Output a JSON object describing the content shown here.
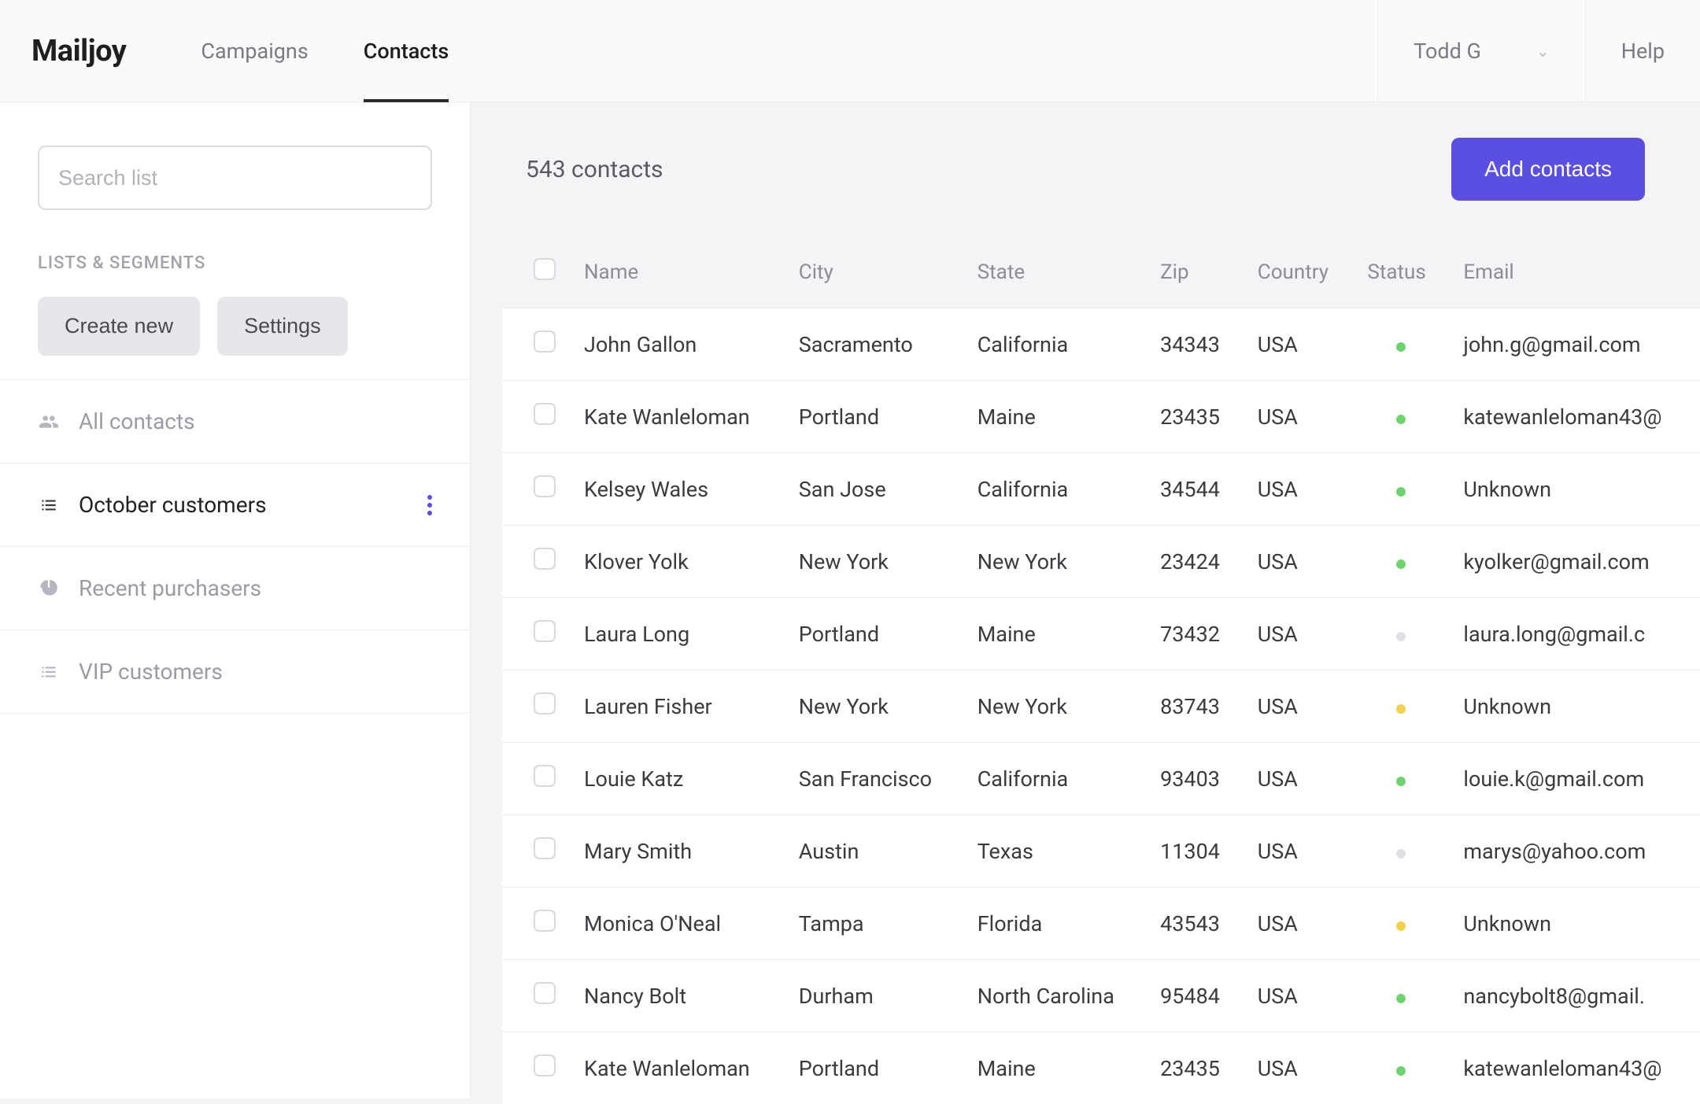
{
  "header": {
    "brand": "Mailjoy",
    "nav": {
      "campaigns": "Campaigns",
      "contacts": "Contacts"
    },
    "user": "Todd G",
    "help": "Help"
  },
  "sidebar": {
    "search_placeholder": "Search list",
    "section_label": "LISTS & SEGMENTS",
    "create_new": "Create new",
    "settings": "Settings",
    "items": [
      {
        "label": "All contacts",
        "icon": "group-icon",
        "active": false
      },
      {
        "label": "October customers",
        "icon": "list-icon",
        "active": true
      },
      {
        "label": "Recent purchasers",
        "icon": "pie-icon",
        "active": false
      },
      {
        "label": "VIP customers",
        "icon": "list-icon",
        "active": false
      }
    ]
  },
  "main": {
    "count_text": "543 contacts",
    "add_button": "Add contacts",
    "columns": {
      "name": "Name",
      "city": "City",
      "state": "State",
      "zip": "Zip",
      "country": "Country",
      "status": "Status",
      "email": "Email"
    },
    "rows": [
      {
        "name": "John Gallon",
        "city": "Sacramento",
        "state": "California",
        "zip": "34343",
        "country": "USA",
        "status": "green",
        "email": "john.g@gmail.com"
      },
      {
        "name": "Kate Wanleloman",
        "city": "Portland",
        "state": "Maine",
        "zip": "23435",
        "country": "USA",
        "status": "green",
        "email": "katewanleloman43@"
      },
      {
        "name": "Kelsey Wales",
        "city": "San Jose",
        "state": "California",
        "zip": "34544",
        "country": "USA",
        "status": "green",
        "email": "Unknown"
      },
      {
        "name": "Klover Yolk",
        "city": "New York",
        "state": "New York",
        "zip": "23424",
        "country": "USA",
        "status": "green",
        "email": "kyolker@gmail.com"
      },
      {
        "name": "Laura Long",
        "city": "Portland",
        "state": "Maine",
        "zip": "73432",
        "country": "USA",
        "status": "grey",
        "email": "laura.long@gmail.c"
      },
      {
        "name": "Lauren Fisher",
        "city": "New York",
        "state": "New York",
        "zip": "83743",
        "country": "USA",
        "status": "yellow",
        "email": "Unknown"
      },
      {
        "name": "Louie Katz",
        "city": "San Francisco",
        "state": "California",
        "zip": "93403",
        "country": "USA",
        "status": "green",
        "email": "louie.k@gmail.com"
      },
      {
        "name": "Mary Smith",
        "city": "Austin",
        "state": "Texas",
        "zip": "11304",
        "country": "USA",
        "status": "grey",
        "email": "marys@yahoo.com"
      },
      {
        "name": "Monica O'Neal",
        "city": "Tampa",
        "state": "Florida",
        "zip": "43543",
        "country": "USA",
        "status": "yellow",
        "email": "Unknown"
      },
      {
        "name": "Nancy Bolt",
        "city": "Durham",
        "state": "North Carolina",
        "zip": "95484",
        "country": "USA",
        "status": "green",
        "email": "nancybolt8@gmail."
      },
      {
        "name": "Kate Wanleloman",
        "city": "Portland",
        "state": "Maine",
        "zip": "23435",
        "country": "USA",
        "status": "green",
        "email": "katewanleloman43@"
      }
    ]
  },
  "colors": {
    "accent": "#5a4fe0",
    "status_green": "#6ed36e",
    "status_yellow": "#f2d24b",
    "status_grey": "#e0e0e4"
  }
}
